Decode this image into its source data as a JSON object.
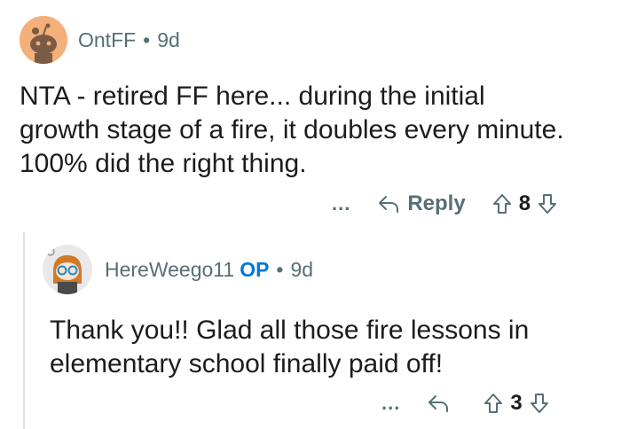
{
  "comments": [
    {
      "username": "OntFF",
      "age": "9d",
      "body": "NTA - retired FF here... during the initial growth stage of a fire, it doubles every minute.  100% did the right thing.",
      "more": "...",
      "reply_label": "Reply",
      "score": "8"
    },
    {
      "username": "HereWeego11",
      "op_badge": "OP",
      "age": "9d",
      "body": "Thank you!! Glad all those fire lessons in elementary school finally paid off!",
      "more": "...",
      "score": "3"
    }
  ],
  "separator": "•",
  "colors": {
    "meta": "#576f76",
    "op": "#0079d3",
    "text": "#1c1c1c",
    "avatar1_bg": "#f4b07a"
  },
  "icons": [
    "snoo-avatar-icon",
    "reply-arrow-icon",
    "upvote-arrow-icon",
    "downvote-arrow-icon"
  ]
}
